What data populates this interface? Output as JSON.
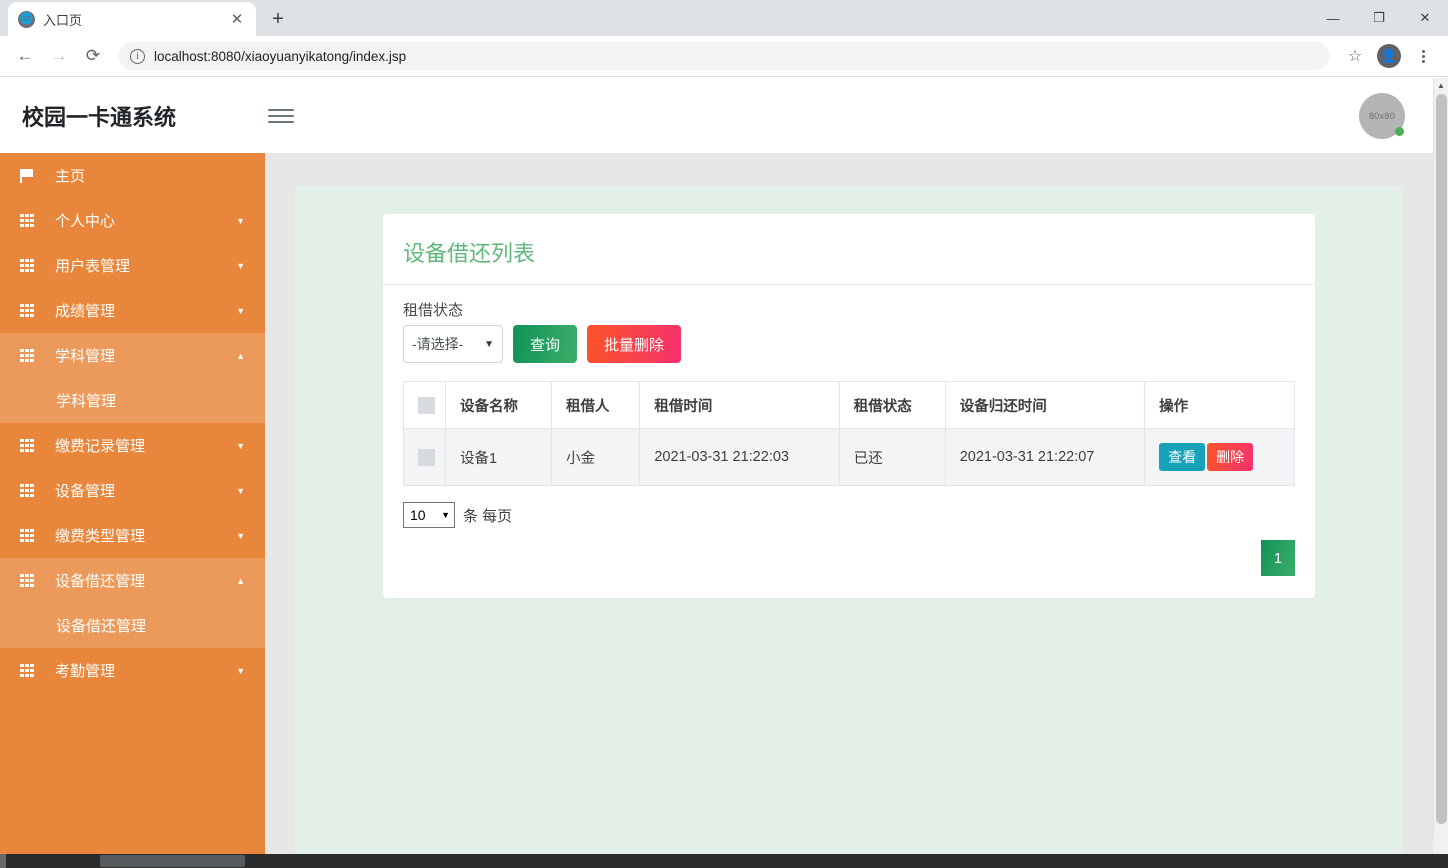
{
  "browser": {
    "tab": {
      "title": "入口页",
      "favicon": "globe-icon",
      "close": "✕"
    },
    "new_tab": "+",
    "window_controls": {
      "minimize": "—",
      "maximize": "❐",
      "close": "✕"
    },
    "nav": {
      "back": "←",
      "forward": "→",
      "reload": "⟳"
    },
    "omnibox": {
      "info_icon": "ⓘ",
      "url": "localhost:8080/xiaoyuanyikatong/index.jsp"
    },
    "bookmark": "☆",
    "profile_icon": "person-icon",
    "menu_icon": "kebab-menu-icon"
  },
  "app": {
    "title": "校园一卡通系统",
    "menu_toggle": "hamburger-icon",
    "avatar": {
      "label": "80x80",
      "status": "online"
    }
  },
  "sidebar": {
    "bg": "#e8873b",
    "active_bg": "#ec9a5b",
    "items": [
      {
        "label": "主页",
        "icon": "flag-icon",
        "caret": "",
        "active": false,
        "sub": []
      },
      {
        "label": "个人中心",
        "icon": "grid-icon",
        "caret": "▼",
        "active": false,
        "sub": []
      },
      {
        "label": "用户表管理",
        "icon": "grid-icon",
        "caret": "▼",
        "active": false,
        "sub": []
      },
      {
        "label": "成绩管理",
        "icon": "grid-icon",
        "caret": "▼",
        "active": false,
        "sub": []
      },
      {
        "label": "学科管理",
        "icon": "grid-icon",
        "caret": "▲",
        "active": true,
        "sub": [
          "学科管理"
        ]
      },
      {
        "label": "缴费记录管理",
        "icon": "grid-icon",
        "caret": "▼",
        "active": false,
        "sub": []
      },
      {
        "label": "设备管理",
        "icon": "grid-icon",
        "caret": "▼",
        "active": false,
        "sub": []
      },
      {
        "label": "缴费类型管理",
        "icon": "grid-icon",
        "caret": "▼",
        "active": false,
        "sub": []
      },
      {
        "label": "设备借还管理",
        "icon": "grid-icon",
        "caret": "▲",
        "active": true,
        "sub": [
          "设备借还管理"
        ]
      },
      {
        "label": "考勤管理",
        "icon": "grid-icon",
        "caret": "▼",
        "active": false,
        "sub": []
      }
    ]
  },
  "main": {
    "card_title": "设备借还列表",
    "filter": {
      "label": "租借状态",
      "select_value": "-请选择-",
      "select_chevron": "⌄",
      "query_button": "查询",
      "bulk_delete_button": "批量删除"
    },
    "table": {
      "headers": [
        "",
        "设备名称",
        "租借人",
        "租借时间",
        "租借状态",
        "设备归还时间",
        "操作"
      ],
      "rows": [
        {
          "device_name": "设备1",
          "borrower": "小金",
          "borrow_time": "2021-03-31 21:22:03",
          "status": "已还",
          "return_time": "2021-03-31 21:22:07",
          "view_button": "查看",
          "delete_button": "删除"
        }
      ]
    },
    "pager": {
      "page_size": "10",
      "page_size_chevron": "⌄",
      "per_page_text": "条 每页",
      "pages": [
        "1"
      ]
    }
  },
  "colors": {
    "sidebar_orange": "#e8873b",
    "title_green": "#62b87c",
    "content_mint": "#e3f0e8",
    "gray_surround": "#e7e7e7",
    "btn_green": "#119259",
    "btn_red": "#fb5428",
    "btn_teal": "#17a2b8"
  }
}
